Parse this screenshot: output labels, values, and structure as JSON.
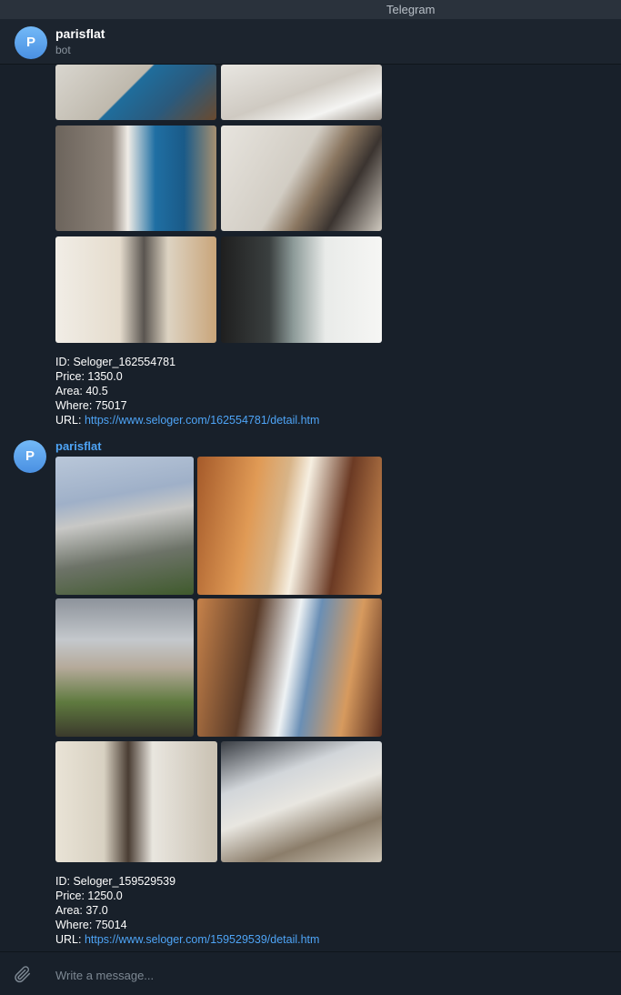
{
  "window": {
    "title": "Telegram"
  },
  "chat": {
    "name": "parisflat",
    "status": "bot",
    "avatar_letter": "P"
  },
  "messages": [
    {
      "id_line": "ID: Seloger_162554781",
      "price_line": "Price: 1350.0",
      "area_line": "Area: 40.5",
      "where_line": "Where: 75017",
      "url_label": "URL: ",
      "url": "https://www.seloger.com/162554781/detail.htm"
    },
    {
      "sender": "parisflat",
      "avatar_letter": "P",
      "id_line": "ID: Seloger_159529539",
      "price_line": "Price: 1250.0",
      "area_line": "Area: 37.0",
      "where_line": "Where: 75014",
      "url_label": "URL: ",
      "url": "https://www.seloger.com/159529539/detail.htm"
    }
  ],
  "composer": {
    "placeholder": "Write a message..."
  },
  "icons": {
    "attach": "paperclip-icon"
  },
  "colors": {
    "background": "#18202a",
    "accent": "#4ea4f6",
    "header": "#1c242e"
  }
}
